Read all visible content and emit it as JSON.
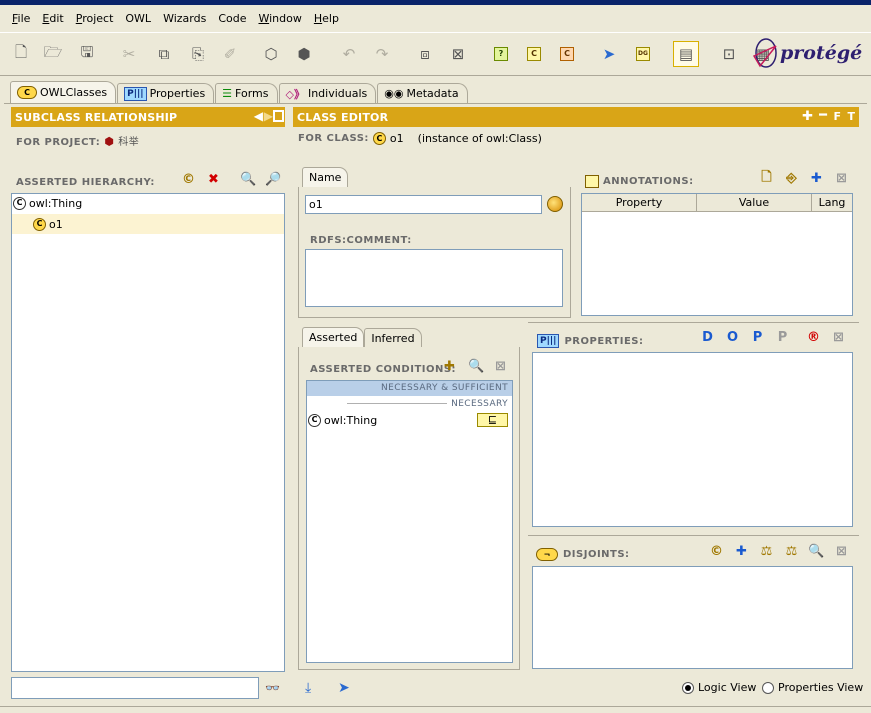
{
  "menu": [
    "File",
    "Edit",
    "Project",
    "OWL",
    "Wizards",
    "Code",
    "Window",
    "Help"
  ],
  "menu_underline": [
    "F",
    "E",
    "P",
    "",
    "",
    "",
    "W",
    "H"
  ],
  "logo": {
    "text": "protégé"
  },
  "tabs": [
    {
      "label": "OWLClasses",
      "icon": "class-icon"
    },
    {
      "label": "Properties",
      "icon": "property-icon"
    },
    {
      "label": "Forms",
      "icon": "forms-icon"
    },
    {
      "label": "Individuals",
      "icon": "individuals-icon"
    },
    {
      "label": "Metadata",
      "icon": "metadata-icon"
    }
  ],
  "left_panel": {
    "title": "SUBCLASS RELATIONSHIP",
    "project_label": "FOR PROJECT:",
    "project_name": "科举",
    "hierarchy_label": "ASSERTED HIERARCHY:",
    "tree": [
      {
        "label": "owl:Thing",
        "selected": false
      },
      {
        "label": "o1",
        "selected": true
      }
    ],
    "search_value": ""
  },
  "class_editor": {
    "title": "CLASS EDITOR",
    "for_class_label": "FOR CLASS:",
    "class_name": "o1",
    "instance_of": "(instance of owl:Class)",
    "name_tab": "Name",
    "name_value": "o1",
    "comment_label": "RDFS:COMMENT:",
    "annotations_label": "ANNOTATIONS:",
    "annotation_columns": [
      "Property",
      "Value",
      "Lang"
    ],
    "conditions_tabs": [
      "Asserted",
      "Inferred"
    ],
    "asserted_conditions_label": "ASSERTED CONDITIONS:",
    "necessary_sufficient": "NECESSARY & SUFFICIENT",
    "necessary": "NECESSARY",
    "condition_item": "owl:Thing",
    "condition_symbol": "⊑",
    "properties_label": "PROPERTIES:",
    "disjoints_label": "DISJOINTS:",
    "view_options": [
      "Logic View",
      "Properties View"
    ],
    "selected_view": "Logic View"
  },
  "colors": {
    "panel_header": "#d9a517",
    "selected_row": "#fcf3d2",
    "background": "#ece9d8"
  }
}
